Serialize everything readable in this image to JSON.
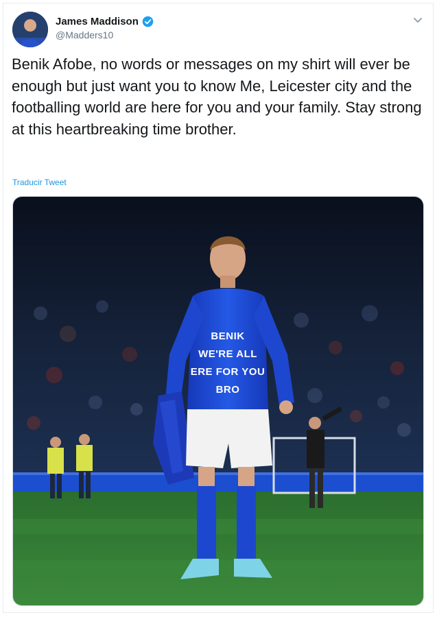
{
  "tweet": {
    "author_name": "James Maddison",
    "author_handle": "@Madders10",
    "text": "Benik Afobe, no words or messages on my shirt will ever be enough but just want you to know Me, Leicester city and the footballing world are here for you and your family. Stay strong at this heartbreaking time brother.",
    "translate_label": "Traducir Tweet"
  },
  "photo": {
    "shirt_message": [
      "BENIK",
      "WE'RE ALL",
      "ERE FOR YOU",
      "BRO"
    ]
  },
  "colors": {
    "verified_badge": "#1da1f2",
    "link": "#1b95e0",
    "kit_blue": "#1f4fd6",
    "pitch_green": "#2f7a33"
  },
  "icons": {
    "verified": "verified-icon",
    "menu": "chevron-down-icon"
  }
}
